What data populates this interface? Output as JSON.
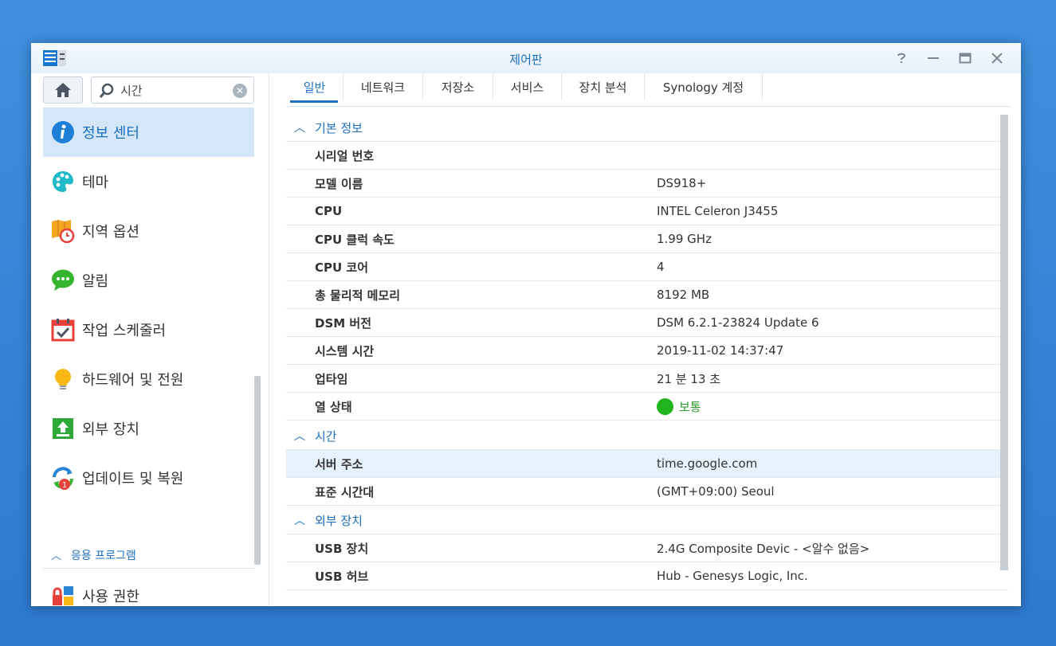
{
  "window": {
    "title": "제어판",
    "help_icon": "help-icon",
    "minimize_icon": "minimize-icon",
    "maximize_icon": "maximize-icon",
    "close_icon": "close-icon"
  },
  "sidebar": {
    "search": {
      "value": "시간",
      "placeholder": ""
    },
    "items": [
      {
        "label": "정보 센터",
        "icon": "info-icon",
        "active": true
      },
      {
        "label": "테마",
        "icon": "palette-icon"
      },
      {
        "label": "지역 옵션",
        "icon": "map-clock-icon"
      },
      {
        "label": "알림",
        "icon": "chat-bubble-icon"
      },
      {
        "label": "작업 스케줄러",
        "icon": "calendar-check-icon"
      },
      {
        "label": "하드웨어 및 전원",
        "icon": "lightbulb-icon"
      },
      {
        "label": "외부 장치",
        "icon": "upload-box-icon"
      },
      {
        "label": "업데이트 및 복원",
        "icon": "update-icon",
        "badge": "1"
      }
    ],
    "section_label": "응용 프로그램",
    "section_items": [
      {
        "label": "사용 권한",
        "icon": "permissions-icon"
      }
    ]
  },
  "tabs": [
    {
      "label": "일반",
      "active": true
    },
    {
      "label": "네트워크"
    },
    {
      "label": "저장소"
    },
    {
      "label": "서비스"
    },
    {
      "label": "장치 분석"
    },
    {
      "label": "Synology 계정"
    }
  ],
  "groups": {
    "basic": {
      "title": "기본 정보",
      "rows": [
        {
          "key": "시리얼 번호",
          "value": ""
        },
        {
          "key": "모델 이름",
          "value": "DS918+"
        },
        {
          "key": "CPU",
          "value": "INTEL Celeron J3455"
        },
        {
          "key": "CPU 클럭 속도",
          "value": "1.99 GHz"
        },
        {
          "key": "CPU 코어",
          "value": "4"
        },
        {
          "key": "총 물리적 메모리",
          "value": "8192 MB"
        },
        {
          "key": "DSM 버전",
          "value": "DSM 6.2.1-23824 Update 6"
        },
        {
          "key": "시스템 시간",
          "value": "2019-11-02 14:37:47"
        },
        {
          "key": "업타임",
          "value": "21 분 13 초"
        },
        {
          "key": "열 상태",
          "value": "보통",
          "status_color": "#21b51e"
        }
      ]
    },
    "time": {
      "title": "시간",
      "rows": [
        {
          "key": "서버 주소",
          "value": "time.google.com",
          "highlighted": true
        },
        {
          "key": "표준 시간대",
          "value": "(GMT+09:00) Seoul"
        }
      ]
    },
    "external": {
      "title": "외부 장치",
      "rows": [
        {
          "key": "USB 장치",
          "value": "2.4G Composite Devic - <알수 없음>"
        },
        {
          "key": "USB 허브",
          "value": "Hub - Genesys Logic, Inc."
        }
      ]
    }
  },
  "colors": {
    "accent": "#1c6fc0",
    "active_bg": "#d4e7f8",
    "desktop_bg": "#3a88d8",
    "status_ok": "#21b51e",
    "badge_red": "#e8413b"
  }
}
